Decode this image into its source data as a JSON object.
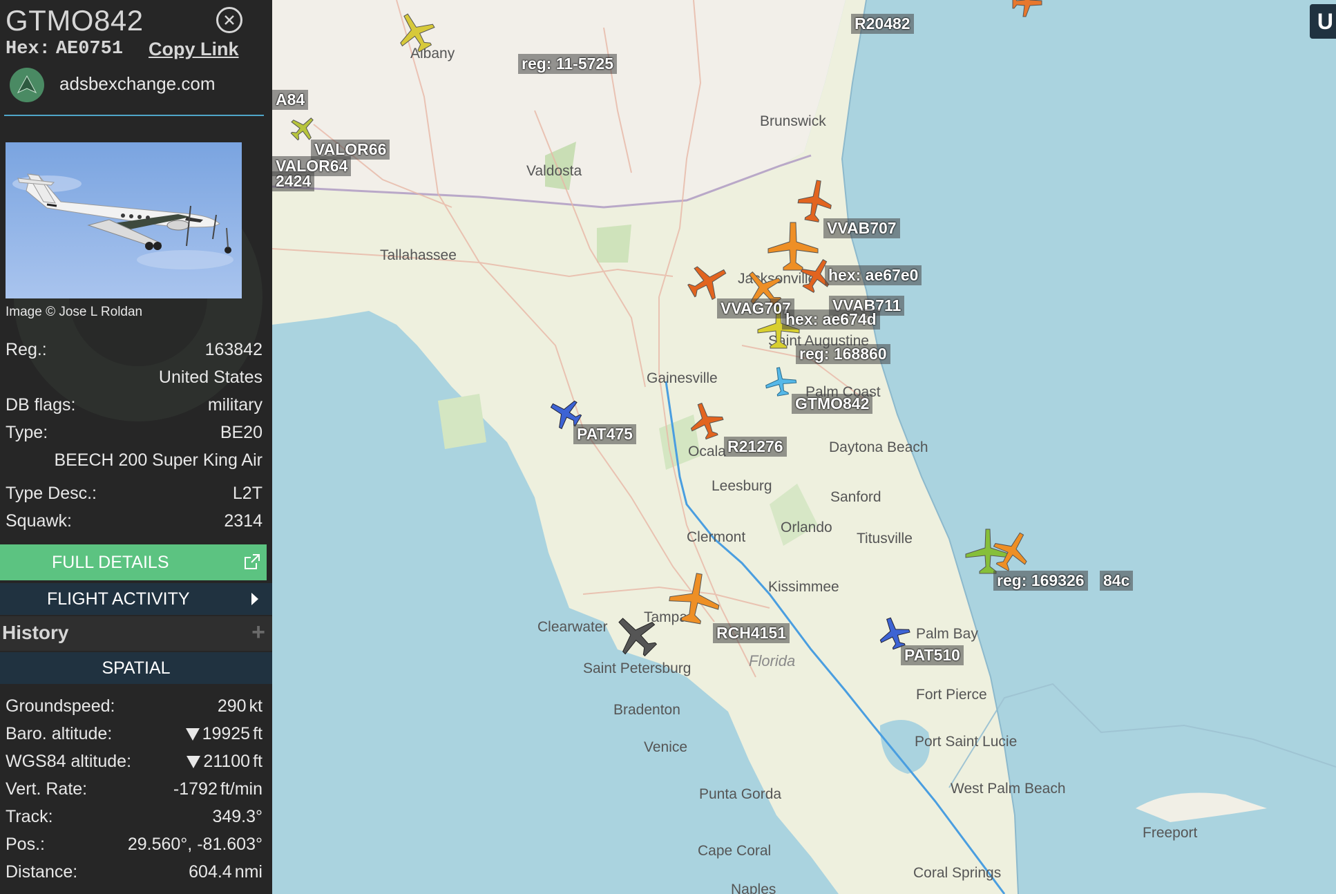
{
  "sidebar": {
    "callsign": "GTMO842",
    "hex_label": "Hex:",
    "hex_value": "AE0751",
    "copy_link": "Copy Link",
    "site": "adsbexchange.com",
    "photo_credit": "Image © Jose L Roldan",
    "details": {
      "reg_label": "Reg.:",
      "reg_value": "163842",
      "country": "United States",
      "dbflags_label": "DB flags:",
      "dbflags_value": "military",
      "type_label": "Type:",
      "type_value": "BE20",
      "type_full": "BEECH 200 Super King Air",
      "typedesc_label": "Type Desc.:",
      "typedesc_value": "L2T",
      "squawk_label": "Squawk:",
      "squawk_value": "2314"
    },
    "full_details": "FULL DETAILS",
    "flight_activity": "FLIGHT ACTIVITY",
    "history": "History",
    "spatial": "SPATIAL",
    "spatial_rows": {
      "gs_label": "Groundspeed:",
      "gs_value": "290",
      "gs_unit": "kt",
      "baro_label": "Baro. altitude:",
      "baro_value": "19925",
      "baro_unit": "ft",
      "wgs_label": "WGS84 altitude:",
      "wgs_value": "21100",
      "wgs_unit": "ft",
      "vr_label": "Vert. Rate:",
      "vr_value": "-1792",
      "vr_unit": "ft/min",
      "track_label": "Track:",
      "track_value": "349.3°",
      "pos_label": "Pos.:",
      "pos_value": "29.560°, -81.603°",
      "dist_label": "Distance:",
      "dist_value": "604.4",
      "dist_unit": "nmi"
    }
  },
  "map": {
    "cities": [
      "Albany",
      "Brunswick",
      "Valdosta",
      "Tallahassee",
      "Gainesville",
      "Saint Augustine",
      "Palm Coast",
      "Daytona Beach",
      "Ocala",
      "Leesburg",
      "Sanford",
      "Clermont",
      "Orlando",
      "Titusville",
      "Kissimmee",
      "Clearwater",
      "Tampa",
      "Saint Petersburg",
      "Bradenton",
      "Venice",
      "Punta Gorda",
      "Cape Coral",
      "Naples",
      "Palm Bay",
      "Fort Pierce",
      "Port Saint Lucie",
      "West Palm Beach",
      "Coral Springs",
      "Freeport",
      "Florida",
      "Jacksonville"
    ],
    "aircraft_labels": [
      "R20482",
      "reg: 11-5725",
      "A84",
      "VALOR66",
      "VALOR64",
      "2424",
      "VVAB707",
      "hex: ae67e0",
      "VVAG707",
      "VVAB711",
      "hex: ae674d",
      "reg: 168860",
      "GTMO842",
      "PAT475",
      "R21276",
      "reg: 169326",
      "84c",
      "RCH4151",
      "PAT510"
    ],
    "top_right_button": "U"
  },
  "colors": {
    "sidebar_bg": "#262626",
    "full_details_bg": "#5cc381",
    "nav_bg": "#203240",
    "track_line": "#4a9ee0",
    "water": "#aad3df",
    "land": "#f0eee4"
  }
}
